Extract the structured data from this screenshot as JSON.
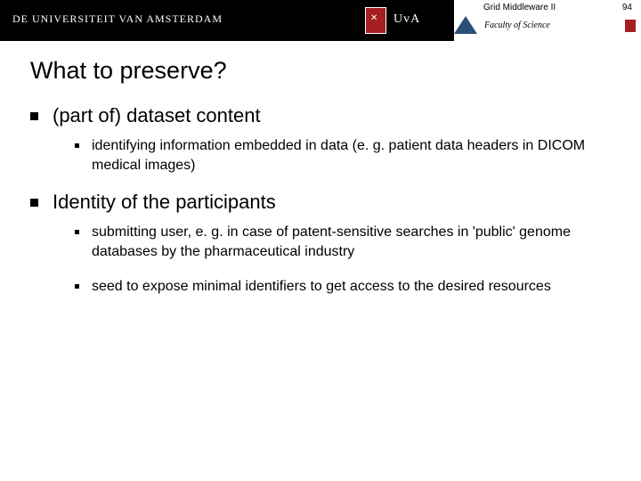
{
  "header": {
    "university_line": "DE UNIVERSITEIT VAN AMSTERDAM",
    "short": "UvA",
    "topic": "Grid Middleware II",
    "page_number": "94",
    "faculty": "Faculty of Science"
  },
  "slide": {
    "title": "What to preserve?",
    "items": [
      {
        "label": "(part of) dataset content",
        "subs": [
          "identifying information embedded in data (e. g. patient data headers in DICOM medical images)"
        ]
      },
      {
        "label": "Identity of the participants",
        "subs": [
          "submitting user, e. g. in case of patent-sensitive searches in 'public' genome databases by the pharmaceutical industry",
          "seed to expose minimal identifiers to get access to the desired resources"
        ]
      }
    ]
  }
}
